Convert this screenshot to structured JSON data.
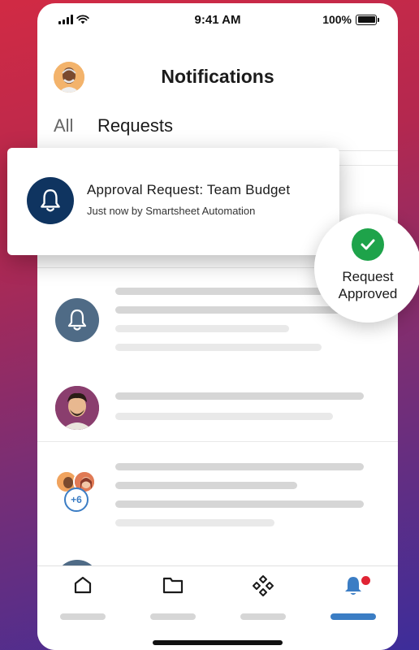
{
  "status_bar": {
    "time": "9:41 AM",
    "battery": "100%"
  },
  "header": {
    "title": "Notifications"
  },
  "tabs": [
    {
      "label": "All",
      "active": false
    },
    {
      "label": "Requests",
      "active": true
    }
  ],
  "popup": {
    "title": "Approval Request: Team Budget",
    "subtitle": "Just now by Smartsheet Automation",
    "icon": "bell-icon"
  },
  "approved_badge": {
    "line1": "Request",
    "line2": "Approved",
    "icon": "check-icon"
  },
  "list": {
    "group_count": "+6"
  },
  "bottom_nav": [
    {
      "icon": "home-icon",
      "active": false
    },
    {
      "icon": "folder-icon",
      "active": false
    },
    {
      "icon": "grid-diamond-icon",
      "active": false
    },
    {
      "icon": "bell-icon",
      "active": true,
      "badge": true
    }
  ],
  "colors": {
    "accent": "#3b7dc4",
    "popup_icon_bg": "#0f3460",
    "bell_avatar_bg": "#4f6b86",
    "success": "#1ea34a",
    "badge": "#e02434"
  }
}
